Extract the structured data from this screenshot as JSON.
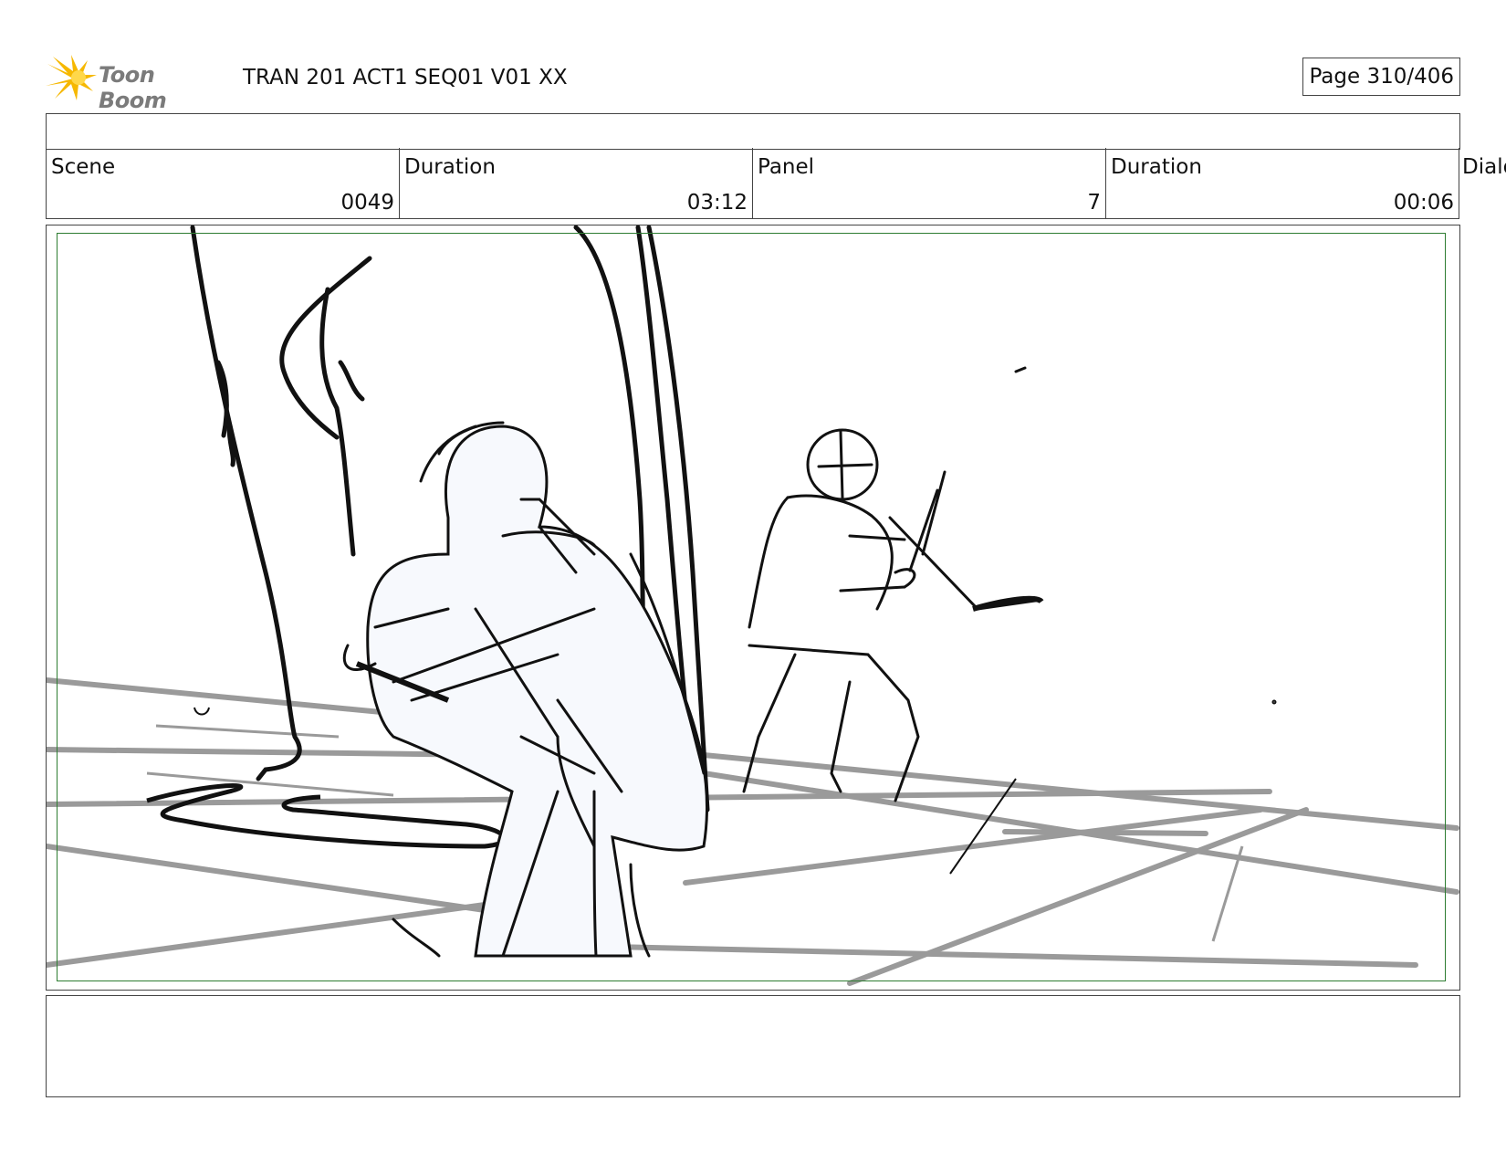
{
  "header": {
    "logo_text": "Toon Boom",
    "title": "TRAN 201 ACT1 SEQ01 V01 XX",
    "page": "Page 310/406"
  },
  "info": {
    "scene_label": "Scene",
    "scene_value": "0049",
    "scene_duration_label": "Duration",
    "scene_duration_value": "03:12",
    "panel_label": "Panel",
    "panel_value": "7",
    "panel_duration_label": "Duration",
    "panel_duration_value": "00:06",
    "dialog_label": "Dialo"
  },
  "colors": {
    "frame_border": "#444444",
    "safe_area": "#2e7d32",
    "sketch_ink": "#111111",
    "floor_lines": "#9a9a9a",
    "figure_fill": "#f7f9fd",
    "logo_star": "#f6b800"
  },
  "notes_top": "",
  "notes_bottom": ""
}
